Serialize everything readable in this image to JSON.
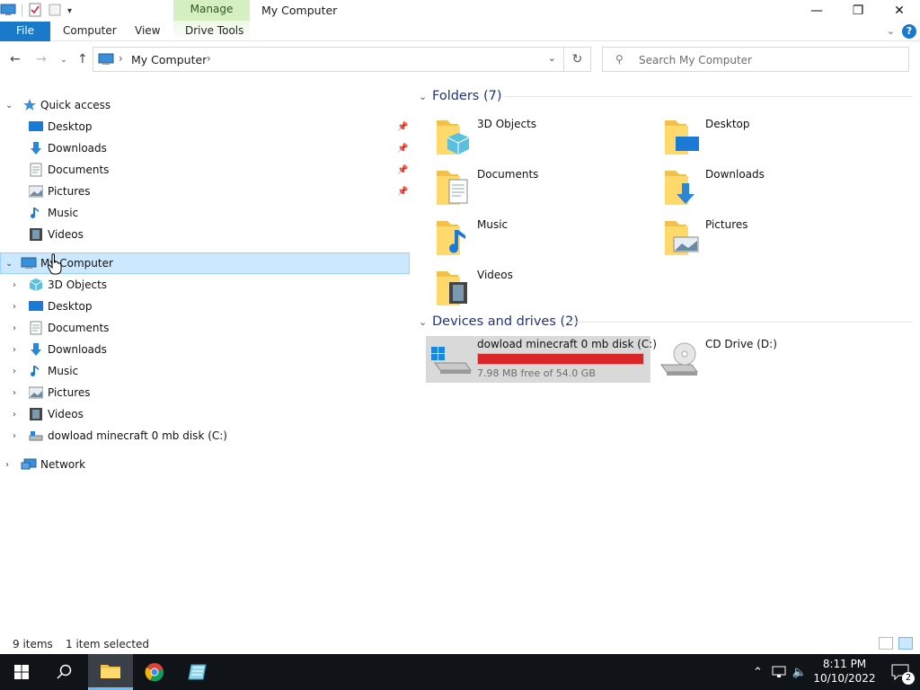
{
  "window": {
    "title": "My Computer",
    "context_tab": "Manage",
    "controls": {
      "minimize": "—",
      "maximize": "❐",
      "close": "✕"
    }
  },
  "ribbon": {
    "tabs": [
      "File",
      "Computer",
      "View",
      "Drive Tools"
    ],
    "help": "?"
  },
  "address": {
    "path": "My Computer",
    "search_placeholder": "Search My Computer"
  },
  "nav": {
    "quick_access": {
      "label": "Quick access",
      "items": [
        {
          "label": "Desktop",
          "icon": "desktop-icon",
          "pinned": true
        },
        {
          "label": "Downloads",
          "icon": "downloads-icon",
          "pinned": true
        },
        {
          "label": "Documents",
          "icon": "documents-icon",
          "pinned": true
        },
        {
          "label": "Pictures",
          "icon": "pictures-icon",
          "pinned": true
        },
        {
          "label": "Music",
          "icon": "music-icon",
          "pinned": false
        },
        {
          "label": "Videos",
          "icon": "videos-icon",
          "pinned": false
        }
      ]
    },
    "my_computer": {
      "label": "My Computer",
      "items": [
        {
          "label": "3D Objects",
          "icon": "3d-objects-icon"
        },
        {
          "label": "Desktop",
          "icon": "desktop-icon"
        },
        {
          "label": "Documents",
          "icon": "documents-icon"
        },
        {
          "label": "Downloads",
          "icon": "downloads-icon"
        },
        {
          "label": "Music",
          "icon": "music-icon"
        },
        {
          "label": "Pictures",
          "icon": "pictures-icon"
        },
        {
          "label": "Videos",
          "icon": "videos-icon"
        },
        {
          "label": "dowload minecraft 0 mb disk (C:)",
          "icon": "drive-icon"
        }
      ]
    },
    "network": {
      "label": "Network"
    }
  },
  "content": {
    "folders_header": "Folders (7)",
    "folders": [
      {
        "label": "3D Objects",
        "icon": "3d-objects-folder-icon"
      },
      {
        "label": "Desktop",
        "icon": "desktop-folder-icon"
      },
      {
        "label": "Documents",
        "icon": "documents-folder-icon"
      },
      {
        "label": "Downloads",
        "icon": "downloads-folder-icon"
      },
      {
        "label": "Music",
        "icon": "music-folder-icon"
      },
      {
        "label": "Pictures",
        "icon": "pictures-folder-icon"
      },
      {
        "label": "Videos",
        "icon": "videos-folder-icon"
      }
    ],
    "drives_header": "Devices and drives (2)",
    "drives": [
      {
        "label": "dowload minecraft 0 mb disk (C:)",
        "free_text": "7.98 MB free of 54.0 GB",
        "used_fraction": 0.9999,
        "icon": "windows-drive-icon",
        "selected": true
      },
      {
        "label": "CD Drive (D:)",
        "icon": "cd-drive-icon",
        "selected": false
      }
    ]
  },
  "status": {
    "items_count": "9 items",
    "selection": "1 item selected"
  },
  "taskbar": {
    "time": "8:11 PM",
    "date": "10/10/2022",
    "notification_count": "2",
    "colors": {
      "accent": "#76b9ed",
      "bar": "#101418"
    }
  },
  "colors": {
    "file_tab": "#1979ca",
    "manage_tab": "#d6efc2",
    "selection": "#cce8ff",
    "drive_bar_full": "#da2626",
    "group_header": "#1e3287"
  }
}
